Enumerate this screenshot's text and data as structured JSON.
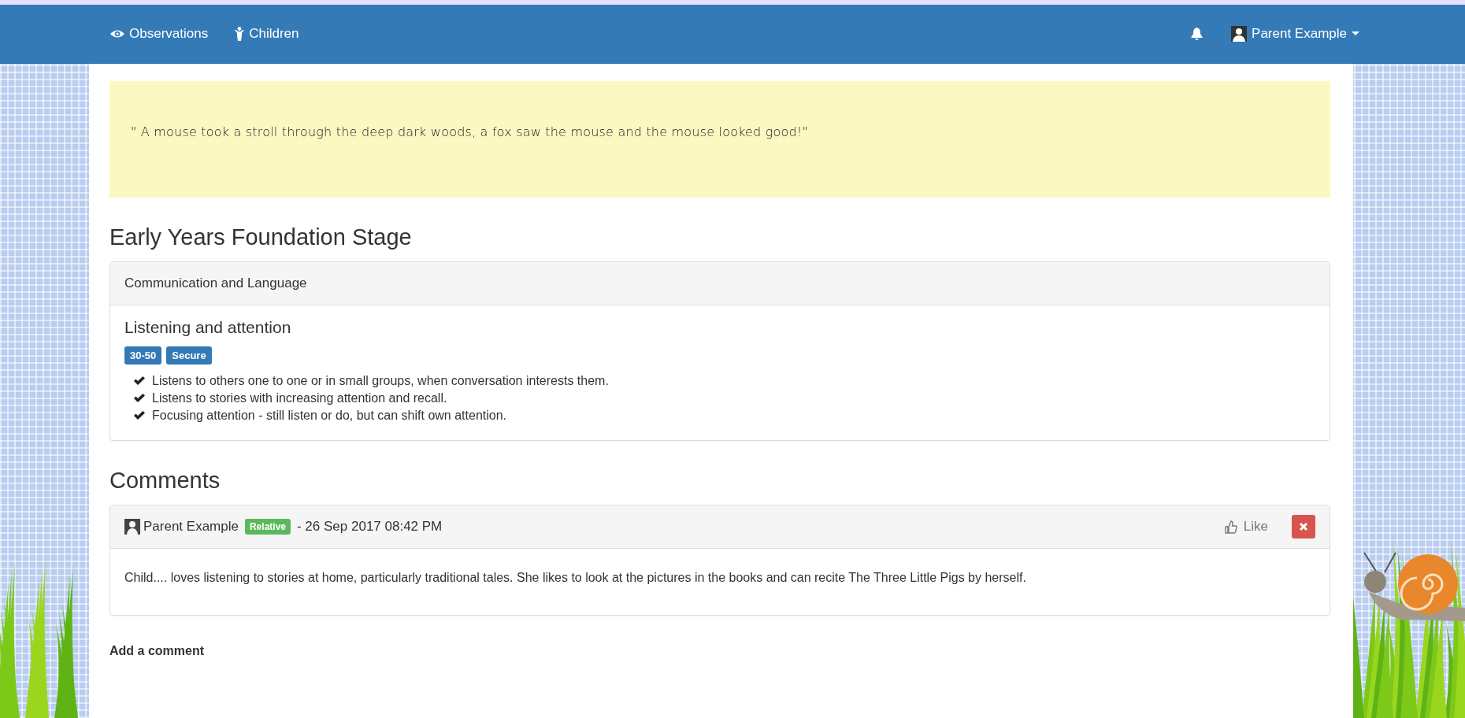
{
  "navbar": {
    "links": [
      {
        "label": "Observations"
      },
      {
        "label": "Children"
      }
    ],
    "user": "Parent Example"
  },
  "notes": {
    "text": "\" A mouse took a stroll through the deep dark woods, a fox saw the mouse and the mouse looked good!\""
  },
  "framework": {
    "title": "Early Years Foundation Stage",
    "area": "Communication and Language",
    "aspect": "Listening and attention",
    "labels": [
      "30-50",
      "Secure"
    ],
    "statements": [
      "Listens to others one to one or in small groups, when conversation interests them.",
      "Listens to stories with increasing attention and recall.",
      "Focusing attention - still listen or do, but can shift own attention."
    ]
  },
  "comments": {
    "title": "Comments",
    "items": [
      {
        "author": "Parent Example",
        "role": "Relative",
        "date": "- 26 Sep 2017 08:42 PM",
        "like": "Like",
        "text": "Child.... loves listening to stories at home, particularly traditional tales. She likes to look at the pictures in the books and can recite The Three Little Pigs by herself."
      }
    ],
    "add_label": "Add a comment"
  }
}
